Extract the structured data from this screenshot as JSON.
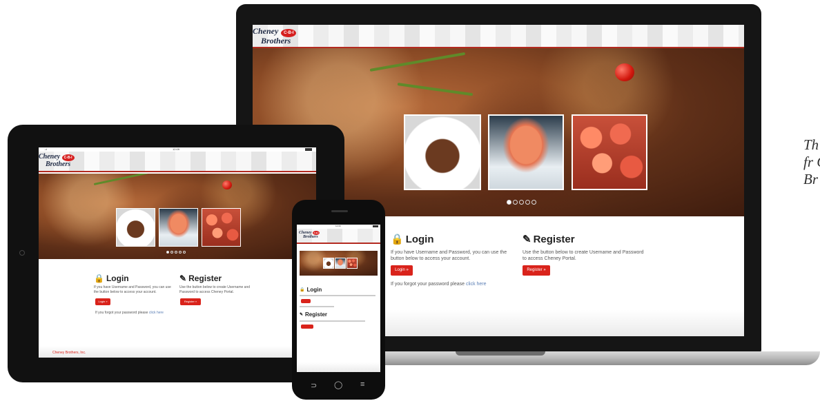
{
  "brand": {
    "line1": "Cheney",
    "line2": "Brothers",
    "badge": "C-B-I",
    "accent": "#d9231b"
  },
  "laptop": {
    "login": {
      "title": "Login",
      "text": "If you have Username and Password, you can use the button below to access your account.",
      "button": "Login »",
      "forgot_prefix": "If you forgot your password please",
      "forgot_link": "click here"
    },
    "register": {
      "title": "Register",
      "text": "Use the button below to create Username and Password to access Cheney Portal.",
      "button": "Register »"
    },
    "carousel_dots": 5,
    "carousel_active": 1
  },
  "tablet": {
    "status_signal": "..ıl",
    "status_time": "12:09",
    "login": {
      "title": "Login",
      "text": "If you have Username and Password, you can use the button below to access your account.",
      "button": "Login »",
      "forgot_prefix": "If you forgot your password please",
      "forgot_link": "click here"
    },
    "register": {
      "title": "Register",
      "text": "Use the button below to create Username and Password to access Cheney Portal.",
      "button": "Register »"
    },
    "footer": "Cheney Brothers, Inc."
  },
  "phone": {
    "status_time": "12:09",
    "login_title": "Login",
    "register_title": "Register",
    "nav": {
      "back": "⊃",
      "home": "◯",
      "menu": "≡"
    }
  },
  "caption": "Th is fr Cl Br cu"
}
